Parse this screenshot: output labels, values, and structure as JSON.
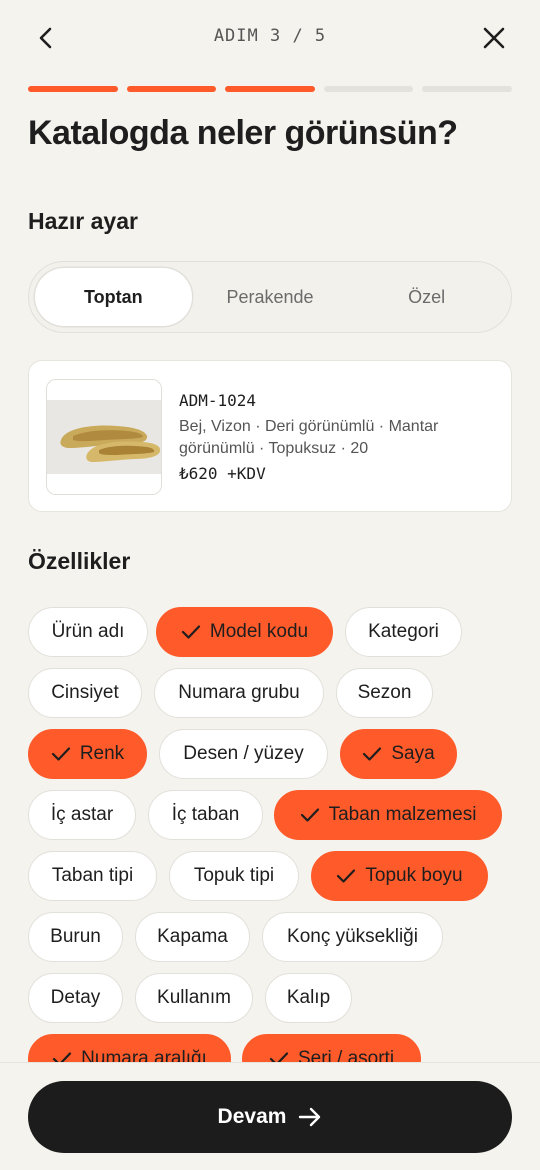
{
  "header": {
    "step_label": "ADIM 3 / 5"
  },
  "progress": {
    "current": 3,
    "total": 5
  },
  "title": "Katalogda neler görünsün?",
  "preset": {
    "heading": "Hazır ayar",
    "options": [
      "Toptan",
      "Perakende",
      "Özel"
    ],
    "selected": "Toptan"
  },
  "preview": {
    "code": "ADM-1024",
    "attributes": "Bej, Vizon · Deri görünümlü · Mantar görünümlü · Topuksuz · 20",
    "price": "₺620 +KDV"
  },
  "features": {
    "heading": "Özellikler",
    "chips": [
      {
        "label": "Ürün adı",
        "selected": false
      },
      {
        "label": "Model kodu",
        "selected": true
      },
      {
        "label": "Kategori",
        "selected": false
      },
      {
        "label": "Cinsiyet",
        "selected": false
      },
      {
        "label": "Numara grubu",
        "selected": false
      },
      {
        "label": "Sezon",
        "selected": false
      },
      {
        "label": "Renk",
        "selected": true
      },
      {
        "label": "Desen / yüzey",
        "selected": false
      },
      {
        "label": "Saya",
        "selected": true
      },
      {
        "label": "İç astar",
        "selected": false
      },
      {
        "label": "İç taban",
        "selected": false
      },
      {
        "label": "Taban malzemesi",
        "selected": true
      },
      {
        "label": "Taban tipi",
        "selected": false
      },
      {
        "label": "Topuk tipi",
        "selected": false
      },
      {
        "label": "Topuk boyu",
        "selected": true
      },
      {
        "label": "Burun",
        "selected": false
      },
      {
        "label": "Kapama",
        "selected": false
      },
      {
        "label": "Konç yüksekliği",
        "selected": false
      },
      {
        "label": "Detay",
        "selected": false
      },
      {
        "label": "Kullanım",
        "selected": false
      },
      {
        "label": "Kalıp",
        "selected": false
      },
      {
        "label": "Numara aralığı",
        "selected": true
      },
      {
        "label": "Seri / asorti",
        "selected": true
      }
    ]
  },
  "footer": {
    "continue_label": "Devam"
  },
  "colors": {
    "accent": "#ff5a2a",
    "dark": "#1c1c1c",
    "background": "#f5f3ee"
  }
}
